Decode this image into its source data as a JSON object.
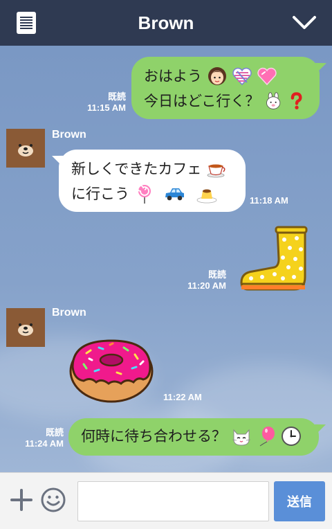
{
  "header": {
    "title": "Brown",
    "menu_icon": "note-list-icon",
    "collapse_icon": "chevron-down-icon"
  },
  "messages": [
    {
      "sender": "me",
      "read": "既読",
      "time": "11:15 AM",
      "line1": "おはよう",
      "line2": "今日はどこ行く？",
      "emoji": [
        "girl-face-icon",
        "striped-heart-icon",
        "pink-heart-icon",
        "cony-bunny-icon",
        "red-question-icon"
      ]
    },
    {
      "sender": "Brown",
      "time": "11:18 AM",
      "line1": "新しくできたカフェ",
      "line2": "に行こう",
      "emoji": [
        "teacup-icon",
        "lollipop-icon",
        "blue-car-icon",
        "pudding-icon"
      ]
    },
    {
      "sender": "me",
      "read": "既読",
      "time": "11:20 AM",
      "sticker": "yellow-rain-boot-sticker"
    },
    {
      "sender": "Brown",
      "time": "11:22 AM",
      "sticker": "pink-donut-sticker"
    },
    {
      "sender": "me",
      "read": "既読",
      "time": "11:24 AM",
      "line1": "何時に待ち合わせる？",
      "emoji": [
        "white-cat-icon",
        "pink-balloon-icon",
        "clock-icon"
      ]
    }
  ],
  "input": {
    "placeholder": "",
    "send_label": "送信",
    "plus_icon": "plus-icon",
    "smile_icon": "smiley-icon"
  },
  "colors": {
    "header_bg": "#2f3a52",
    "my_bubble": "#8fd26a",
    "their_bubble": "#ffffff",
    "send_button": "#5a8fd8"
  }
}
